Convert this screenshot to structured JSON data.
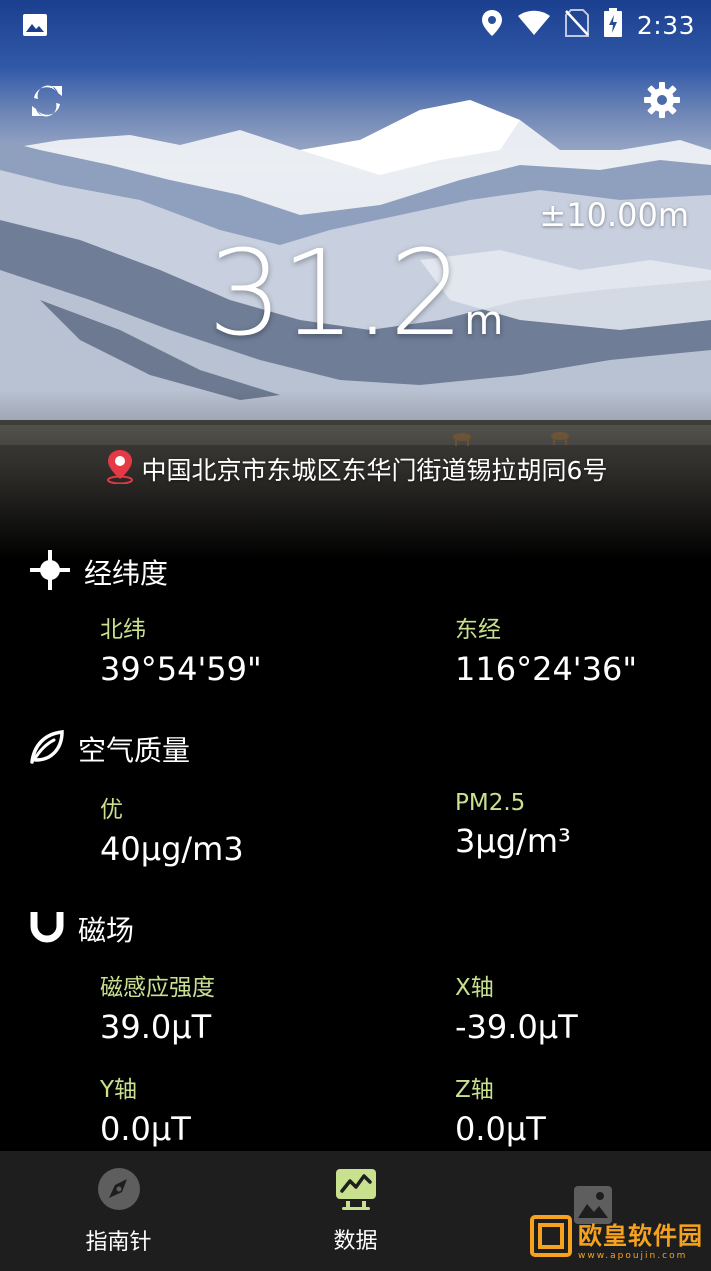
{
  "status_bar": {
    "time": "2:33"
  },
  "hero": {
    "accuracy": "±10.00m",
    "altitude_value": "31.2",
    "altitude_unit": "m",
    "address": "中国北京市东城区东华门街道锡拉胡同6号"
  },
  "sections": {
    "coordinates": {
      "title": "经纬度",
      "items": [
        {
          "label": "北纬",
          "value": "39°54'59\""
        },
        {
          "label": "东经",
          "value": "116°24'36\""
        }
      ]
    },
    "air_quality": {
      "title": "空气质量",
      "items": [
        {
          "label": "优",
          "value": "40μg/m3"
        },
        {
          "label": "PM2.5",
          "value": "3μg/m³"
        }
      ]
    },
    "magnetic": {
      "title": "磁场",
      "items": [
        {
          "label": "磁感应强度",
          "value": "39.0μT"
        },
        {
          "label": "X轴",
          "value": "-39.0μT"
        },
        {
          "label": "Y轴",
          "value": "0.0μT"
        },
        {
          "label": "Z轴",
          "value": "0.0μT"
        }
      ]
    }
  },
  "bottom_nav": {
    "items": [
      {
        "label": "指南针",
        "icon": "compass-icon"
      },
      {
        "label": "数据",
        "icon": "data-chart-icon",
        "active": true
      },
      {
        "label": "",
        "icon": "photo-icon"
      }
    ]
  },
  "watermark": {
    "text": "欧皇软件园",
    "sub": "www.apoujin.com"
  },
  "colors": {
    "label_green": "#c9e08f",
    "nav_bg": "#1e1e1e",
    "active_green": "#c9e08f"
  }
}
